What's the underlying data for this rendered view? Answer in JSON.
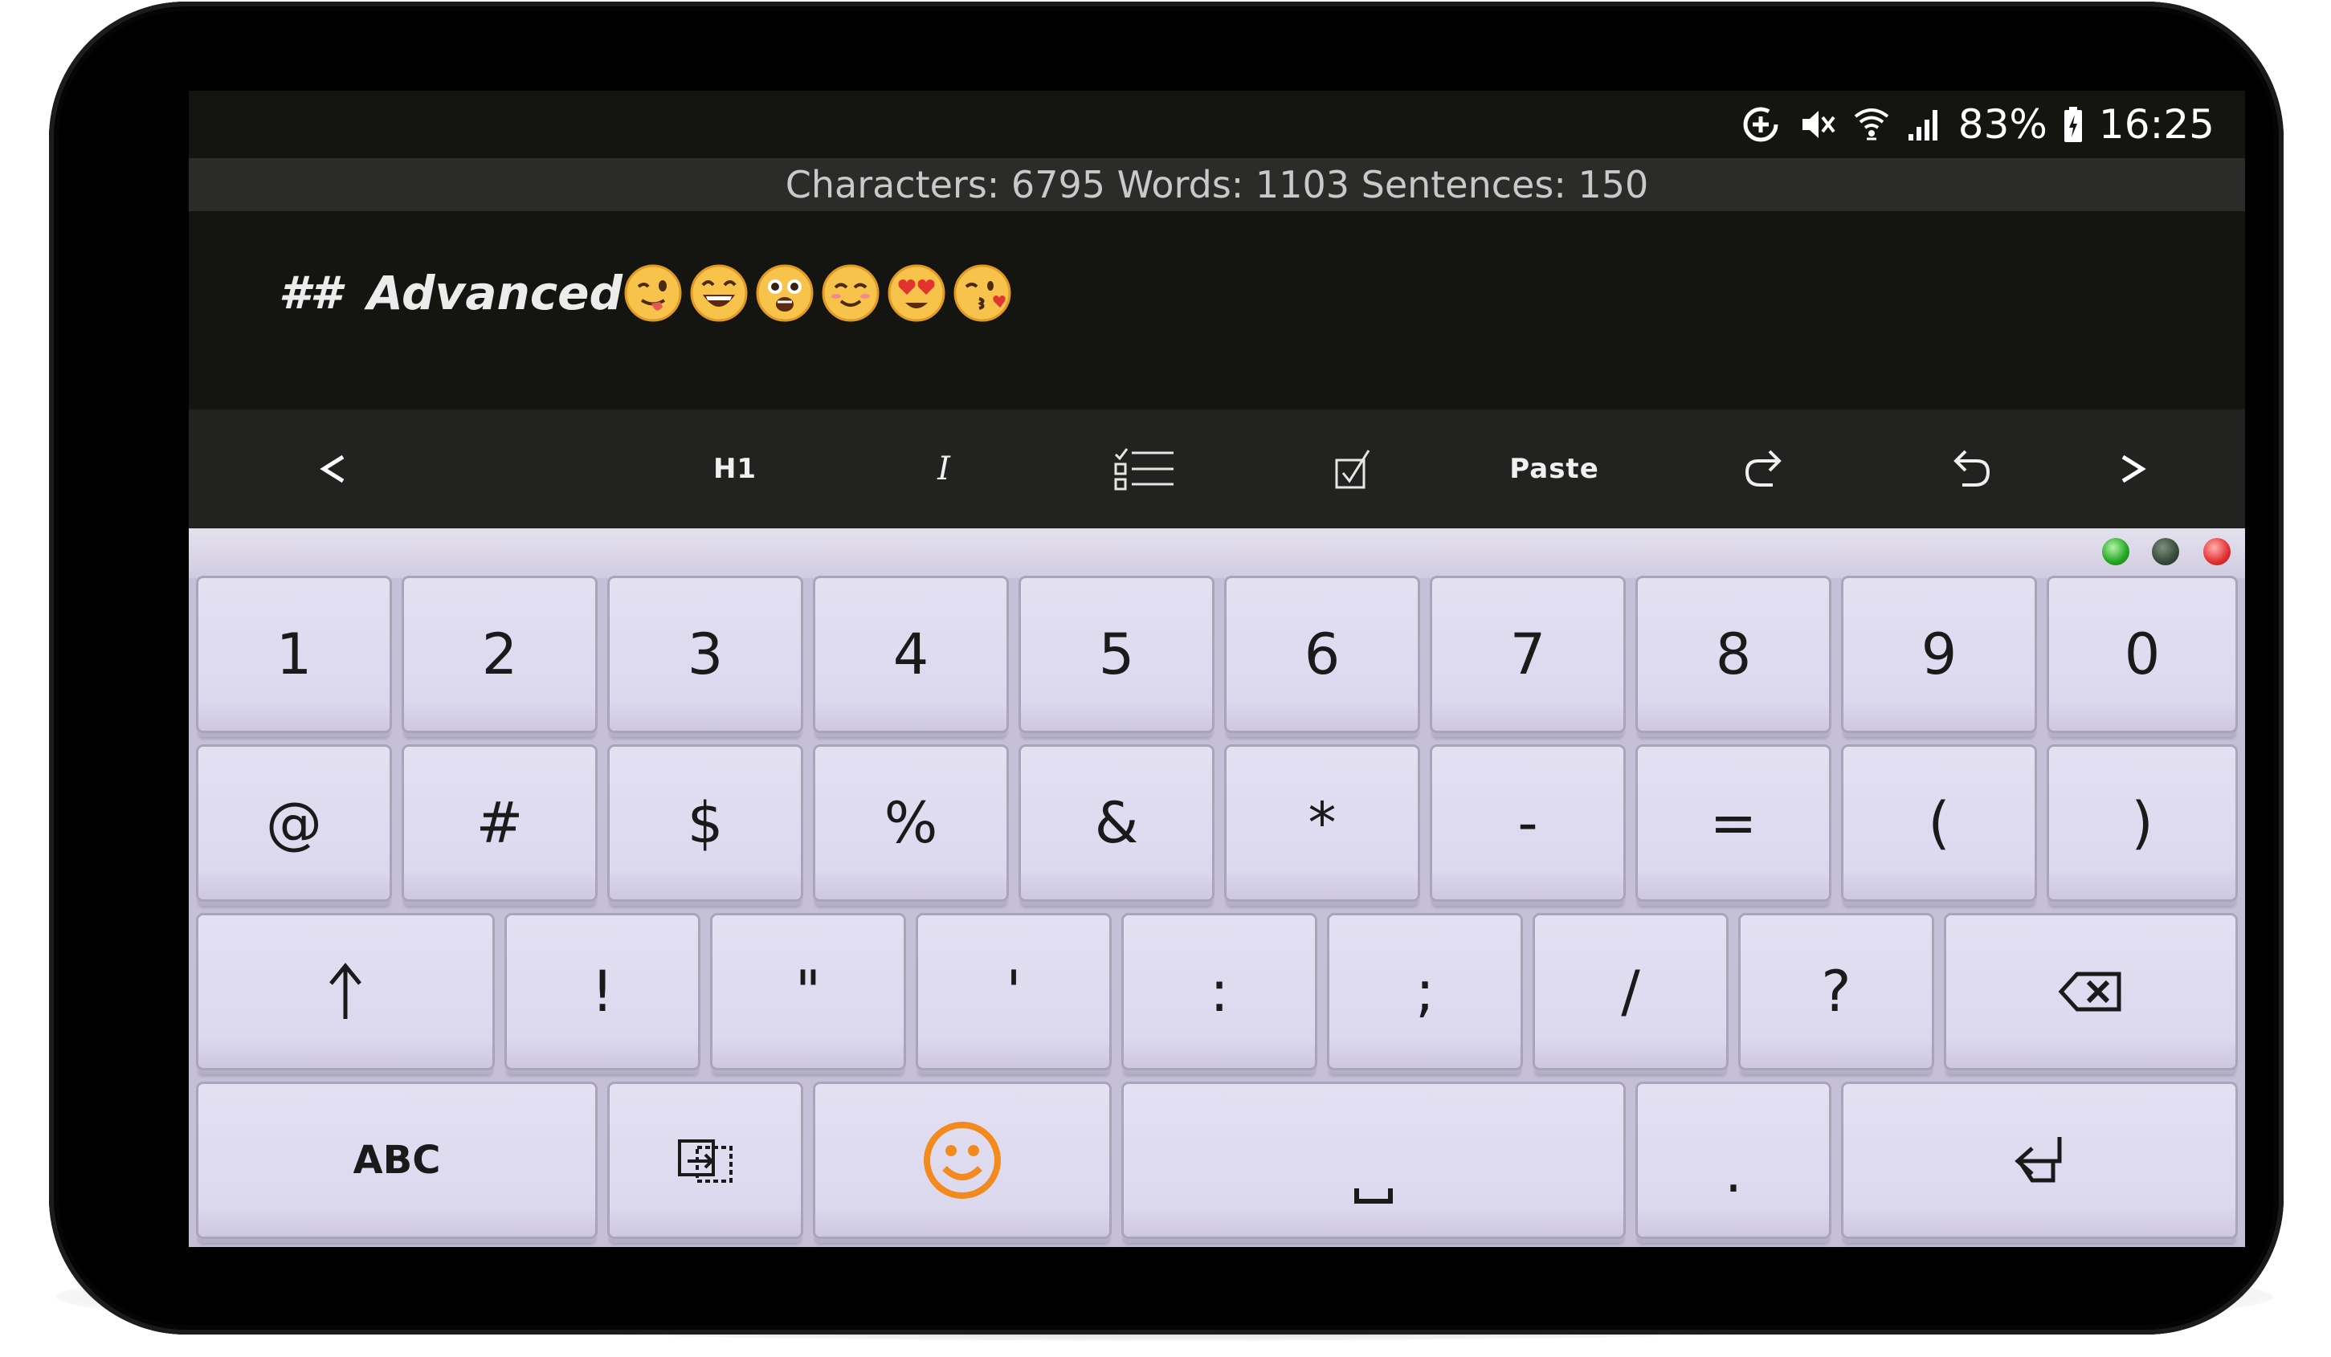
{
  "status_bar": {
    "battery_percent": "83%",
    "time": "16:25",
    "icons": [
      "data-saver-icon",
      "mute-icon",
      "wifi-icon",
      "signal-icon",
      "battery-icon"
    ]
  },
  "counts_bar": {
    "text": "Characters: 6795 Words: 1103 Sentences: 150"
  },
  "editor": {
    "heading_marker": "##",
    "heading_text": "Advanced",
    "emojis": [
      "winking-face-tongue",
      "grinning-squinting-face",
      "astonished-face",
      "smiling-face-blush",
      "heart-eyes-face",
      "kissing-face-heart"
    ]
  },
  "toolbar": {
    "prev": "<",
    "h1": "H1",
    "italic": "I",
    "list_icon": "checklist-icon",
    "checkbox_icon": "checkbox-icon",
    "paste": "Paste",
    "redo_icon": "redo-icon",
    "undo_icon": "undo-icon",
    "next": ">"
  },
  "keyboard": {
    "window_dots": [
      "#22a422",
      "#374a3a",
      "#e23030"
    ],
    "row1": [
      "1",
      "2",
      "3",
      "4",
      "5",
      "6",
      "7",
      "8",
      "9",
      "0"
    ],
    "row2": [
      "@",
      "#",
      "$",
      "%",
      "&",
      "*",
      "-",
      "=",
      "(",
      ")"
    ],
    "row3": [
      "!",
      "\"",
      "'",
      ":",
      ";",
      "/",
      "?"
    ],
    "shift_icon": "shift-arrow-icon",
    "backspace_icon": "backspace-icon",
    "abc": "ABC",
    "layout_switch_icon": "keyboard-switch-icon",
    "emoji_icon": "emoji-icon",
    "space_icon": "space-icon",
    "period": ".",
    "enter_icon": "enter-icon"
  },
  "colors": {
    "screen_bg": "#141411",
    "toolbar_bg": "#222220",
    "key_face": "#dcd8ee",
    "keyboard_bg": "#c5c0d8",
    "emoji_accent": "#f28a1e"
  }
}
